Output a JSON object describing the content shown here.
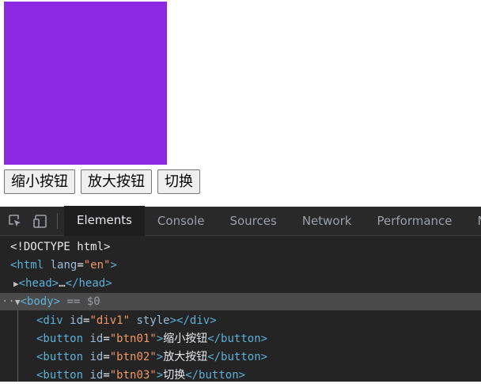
{
  "buttons": {
    "shrink": "缩小按钮",
    "enlarge": "放大按钮",
    "toggle": "切换"
  },
  "devtools": {
    "tabs": [
      "Elements",
      "Console",
      "Sources",
      "Network",
      "Performance",
      "M"
    ],
    "active_tab": "Elements",
    "tree": {
      "doctype": "<!DOCTYPE html>",
      "html_open": "<html",
      "html_attr": "lang",
      "html_val": "\"en\"",
      "head_open": "<head>",
      "ellipsis": "…",
      "head_close": "</head>",
      "body_tag": "<body>",
      "body_eq": "== $0",
      "div_tag": "<div",
      "div_attr_id": "id",
      "div_val_id": "\"div1\"",
      "div_attr_style": "style",
      "div_close": "></div>",
      "btn_tag": "<button",
      "btn_attr": "id",
      "btn01_val": "\"btn01\"",
      "btn02_val": "\"btn02\"",
      "btn03_val": "\"btn03\"",
      "btn_close": "</button>",
      "btn01_text": "缩小按钮",
      "btn02_text": "放大按钮",
      "btn03_text": "切换"
    }
  },
  "colors": {
    "box": "#8d29e2",
    "devtools_bg": "#242424",
    "tag": "#5db0d7",
    "attr_value": "#f29766"
  }
}
